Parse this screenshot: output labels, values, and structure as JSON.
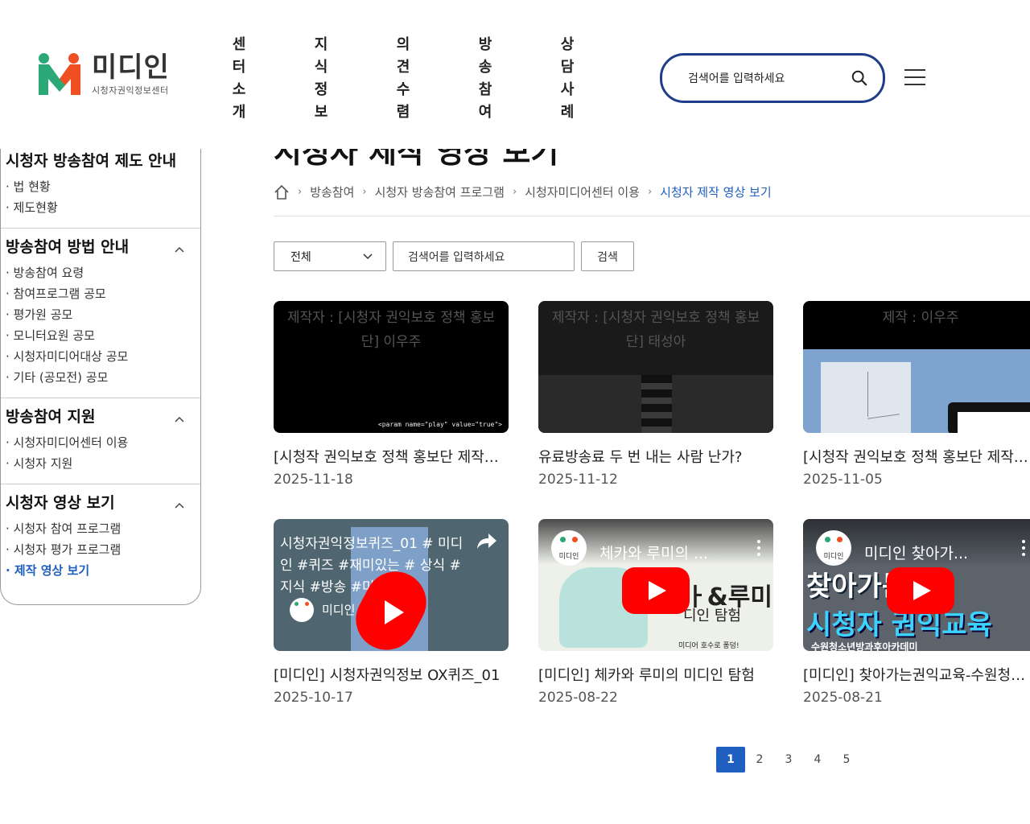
{
  "header": {
    "logo_name": "미디인",
    "logo_sub": "시청자권익정보센터",
    "nav": [
      "센터소개",
      "지식정보",
      "의견수렴",
      "방송참여",
      "상담사례"
    ],
    "search_placeholder": "검색어를 입력하세요"
  },
  "sidebar": {
    "sections": [
      {
        "title": "시청자 방송참여 제도 안내",
        "links": [
          "법 현황",
          "제도현황"
        ]
      },
      {
        "title": "방송참여 방법 안내",
        "links": [
          "방송참여 요령",
          "참여프로그램 공모",
          "평가원 공모",
          "모니터요원 공모",
          "시청자미디어대상 공모",
          "기타 (공모전) 공모"
        ]
      },
      {
        "title": "방송참여 지원",
        "links": [
          "시청자미디어센터 이용",
          "시청자 지원"
        ]
      },
      {
        "title": "시청자 영상 보기",
        "links": [
          "시청자 참여 프로그램",
          "시청자 평가 프로그램",
          "제작 영상 보기"
        ]
      }
    ]
  },
  "page_title": "시청자 제작 영상 보기",
  "breadcrumb": [
    "방송참여",
    "시청자 방송참여 프로그램",
    "시청자미디어센터 이용",
    "시청자 제작 영상 보기"
  ],
  "filter": {
    "select_value": "전체",
    "keyword_placeholder": "검색어를 입력하세요",
    "search_label": "검색"
  },
  "videos": [
    {
      "title": "[시청작 권익보호 정책 홍보단 제작] 이우주",
      "date": "2025-11-18",
      "overlay": "제작자 : [시청자 권익보호 정책 홍보단] 이우주",
      "code": "<param name=\"play\" value=\"true\">"
    },
    {
      "title": "유료방송료 두 번 내는 사람 난가?",
      "date": "2025-11-12",
      "overlay": "제작자 : [시청자 권익보호 정책 홍보단] 태성아"
    },
    {
      "title": "[시청작 권익보호 정책 홍보단 제작] 이우주",
      "date": "2025-11-05",
      "overlay": "제작 : 이우주"
    },
    {
      "title": "[미디인] 시청자권익정보 OX퀴즈_01",
      "date": "2025-10-17",
      "yt_title": "시청자권익정보퀴즈_01 # 미디인 #퀴즈 #재미있는 # 상식 #지식 #방송 #미 ...",
      "channel": "미디인"
    },
    {
      "title": "[미디인] 체카와 루미의 미디인 탐험",
      "date": "2025-08-22",
      "yt_title": "체카와 루미의 ...",
      "channel": "미디인"
    },
    {
      "title": "[미디인] 찾아가는권익교육-수원청소년",
      "date": "2025-08-21",
      "yt_title": "미디인 찾아가...",
      "channel": "미디인"
    }
  ],
  "pagination": [
    "1",
    "2",
    "3",
    "4",
    "5"
  ],
  "colors": {
    "accent": "#1f5fbf",
    "search_border": "#1f3d8a",
    "youtube": "#ff0000"
  }
}
